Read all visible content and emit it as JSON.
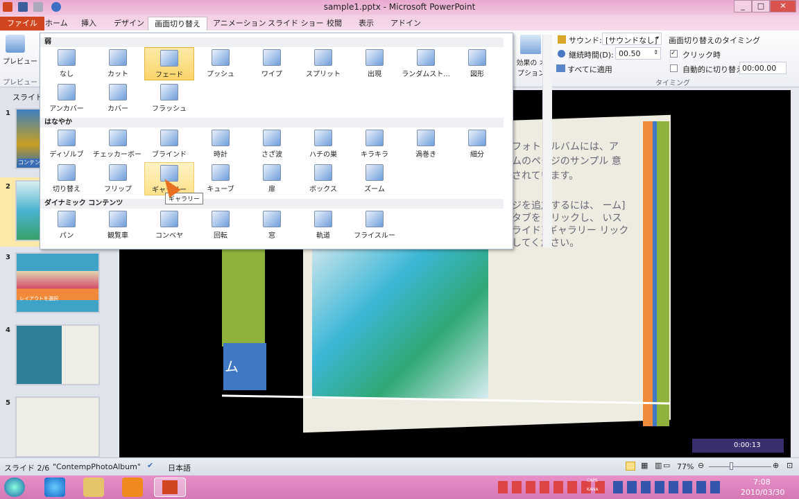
{
  "window": {
    "title": "sample1.pptx - Microsoft PowerPoint"
  },
  "tabs": [
    "ファイル",
    "ホーム",
    "挿入",
    "デザイン",
    "画面切り替え",
    "アニメーション",
    "スライド ショー",
    "校閲",
    "表示",
    "アドイン"
  ],
  "ribbon": {
    "preview_label": "プレビュー",
    "preview_group": "プレビュー",
    "effect_options": "効果の オプション",
    "sound_label": "サウンド:",
    "sound_value": "[サウンドなし]",
    "duration_label": "継続時間(D):",
    "duration_value": "00.50",
    "apply_all": "すべてに適用",
    "timing_header": "画面切り替えのタイミング",
    "on_click": "クリック時",
    "auto_after": "自動的に切り替え",
    "auto_value": "00:00.00",
    "timing_group": "タイミング"
  },
  "gallery": {
    "sections": [
      {
        "title": "弱",
        "items": [
          "なし",
          "カット",
          "フェード",
          "プッシュ",
          "ワイプ",
          "スプリット",
          "出現",
          "ランダムスト...",
          "図形",
          "アンカバー",
          "カバー",
          "フラッシュ"
        ]
      },
      {
        "title": "はなやか",
        "items": [
          "ディゾルブ",
          "チェッカーボード",
          "ブラインド",
          "時計",
          "さざ波",
          "ハチの巣",
          "キラキラ",
          "渦巻き",
          "細分",
          "切り替え",
          "フリップ",
          "ギャラリー",
          "キューブ",
          "扉",
          "ボックス",
          "ズーム"
        ]
      },
      {
        "title": "ダイナミック コンテンツ",
        "items": [
          "パン",
          "観覧車",
          "コンベヤ",
          "回転",
          "窓",
          "軌道",
          "フライスルー"
        ]
      }
    ],
    "selected": "フェード",
    "hovered": "ギャラリー",
    "tooltip": "ギャラリー"
  },
  "slides_pane": {
    "header": "スライド",
    "numbers": [
      "1",
      "2",
      "3",
      "4",
      "5"
    ],
    "thumb1_caption": "コンテンツ",
    "thumb3_caption": "レイアウトを選択"
  },
  "slide": {
    "text1": "フォトアルバムには、ア ムのページのサンプル 意されています。",
    "text2": "ジを追加するには、 ーム] タブをクリックし、 いスライド] ギャラリー リックしてください。",
    "left_text": "ム"
  },
  "player": {
    "time": "0:00:13"
  },
  "status": {
    "slide": "スライド 2/6",
    "theme": "\"ContempPhotoAlbum\"",
    "lang": "日本語",
    "zoom": "77%"
  },
  "taskbar": {
    "time": "7:08",
    "date": "2010/03/30",
    "caps": "CAPS",
    "kana": "KANA"
  }
}
